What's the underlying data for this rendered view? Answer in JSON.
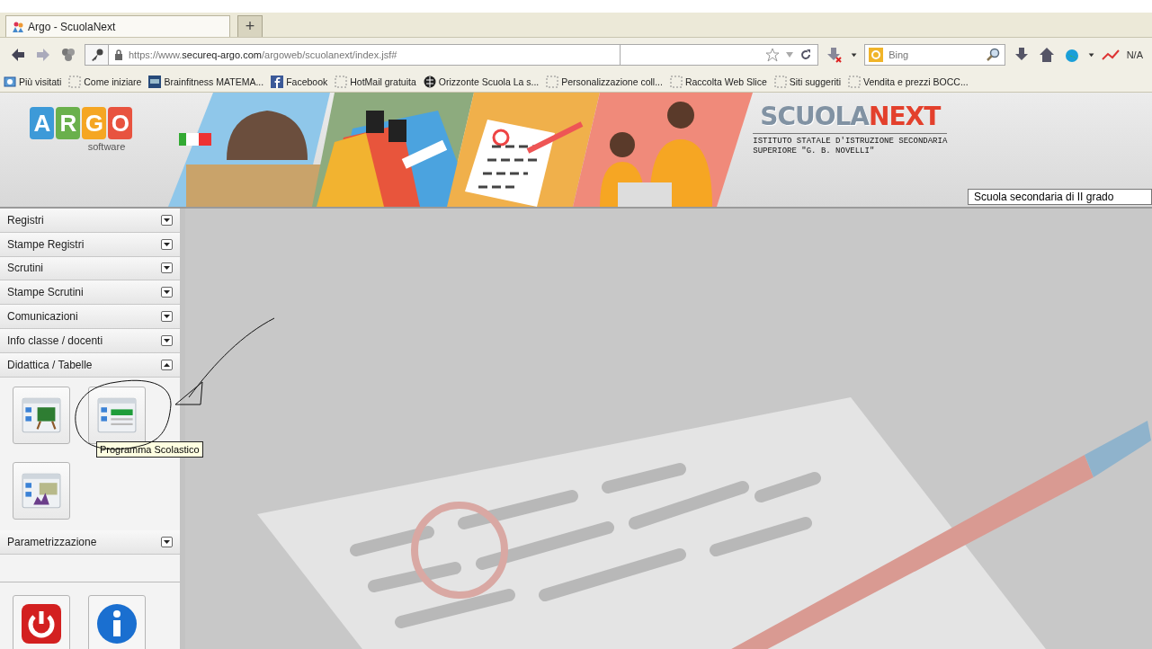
{
  "browser": {
    "tabs": [
      {
        "title": "Argo - ScuolaNext",
        "selected": true
      }
    ],
    "new_tab": "+",
    "url": "https://www.**secureq-argo.com**/argoweb/scuolanext/index.jsf#",
    "search": {
      "placeholder": "Bing"
    },
    "addon_label": "N/A",
    "bookmarks": [
      {
        "label": "Più visitati",
        "kind": "folder"
      },
      {
        "label": "Come iniziare",
        "kind": "page"
      },
      {
        "label": "Brainfitness  MATEMA...",
        "kind": "app"
      },
      {
        "label": "Facebook",
        "kind": "facebook"
      },
      {
        "label": "HotMail gratuita",
        "kind": "page"
      },
      {
        "label": "Orizzonte Scuola  La s...",
        "kind": "globe"
      },
      {
        "label": "Personalizzazione coll...",
        "kind": "page"
      },
      {
        "label": "Raccolta Web Slice",
        "kind": "page"
      },
      {
        "label": "Siti suggeriti",
        "kind": "page"
      },
      {
        "label": "Vendita e prezzi BOCC...",
        "kind": "page"
      }
    ]
  },
  "header": {
    "brand_letters": [
      {
        "letter": "A",
        "color": "#3d9ad8"
      },
      {
        "letter": "R",
        "color": "#6ab04c"
      },
      {
        "letter": "G",
        "color": "#f5a623"
      },
      {
        "letter": "O",
        "color": "#e8533f"
      }
    ],
    "brand_sub": "software",
    "product_name": [
      "SCUOLA",
      "NEXT"
    ],
    "institute": "ISTITUTO STATALE D'ISTRUZIONE SECONDARIA SUPERIORE \"G. B. NOVELLI\"",
    "school_type": "Scuola secondaria di II grado"
  },
  "menu": [
    {
      "label": "Registri",
      "expanded": false
    },
    {
      "label": "Stampe Registri",
      "expanded": false
    },
    {
      "label": "Scrutini",
      "expanded": false
    },
    {
      "label": "Stampe Scrutini",
      "expanded": false
    },
    {
      "label": "Comunicazioni",
      "expanded": false
    },
    {
      "label": "Info classe / docenti",
      "expanded": false
    },
    {
      "label": "Didattica / Tabelle",
      "expanded": true,
      "tiles": [
        {
          "kind": "board"
        },
        {
          "kind": "program",
          "tooltip": "Programma Scolastico"
        },
        {
          "kind": "chart"
        }
      ]
    },
    {
      "label": "Parametrizzazione",
      "expanded": false
    }
  ],
  "footer_buttons": [
    {
      "kind": "power"
    },
    {
      "kind": "info"
    }
  ]
}
